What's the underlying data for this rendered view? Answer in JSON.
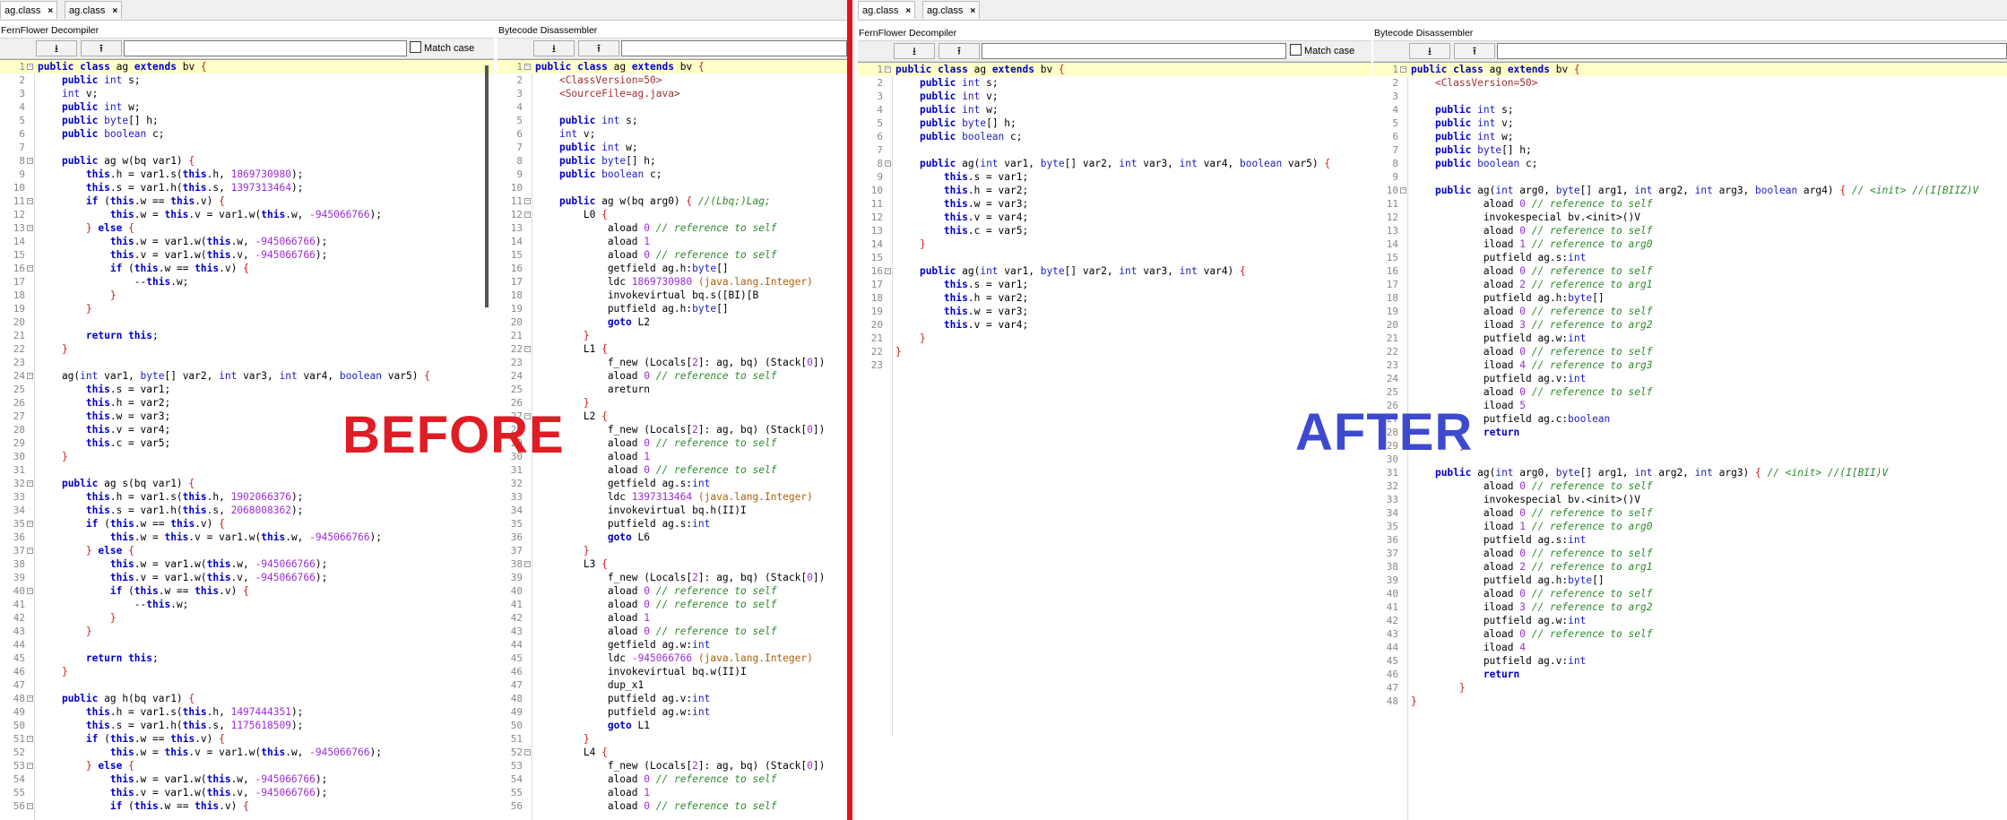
{
  "colors": {
    "before_label": "#e01c24",
    "after_label": "#3d4ad0",
    "divider": "#e0141e",
    "highlight_line": "#ffffc8"
  },
  "left": {
    "tabs": [
      {
        "label": "ag.class",
        "close": "×"
      },
      {
        "label": "ag.class",
        "close": "×"
      }
    ],
    "fernflower": {
      "title": "FernFlower Decompiler",
      "match_case": "Match case",
      "lines": [
        "public class ag extends bv {",
        "    public int s;",
        "    int v;",
        "    public int w;",
        "    public byte[] h;",
        "    public boolean c;",
        "",
        "    public ag w(bq var1) {",
        "        this.h = var1.s(this.h, 1869730980);",
        "        this.s = var1.h(this.s, 1397313464);",
        "        if (this.w == this.v) {",
        "            this.w = this.v = var1.w(this.w, -945066766);",
        "        } else {",
        "            this.w = var1.w(this.w, -945066766);",
        "            this.v = var1.w(this.v, -945066766);",
        "            if (this.w == this.v) {",
        "                --this.w;",
        "            }",
        "        }",
        "",
        "        return this;",
        "    }",
        "",
        "    ag(int var1, byte[] var2, int var3, int var4, boolean var5) {",
        "        this.s = var1;",
        "        this.h = var2;",
        "        this.w = var3;",
        "        this.v = var4;",
        "        this.c = var5;",
        "    }",
        "",
        "    public ag s(bq var1) {",
        "        this.h = var1.s(this.h, 1902066376);",
        "        this.s = var1.h(this.s, 2068008362);",
        "        if (this.w == this.v) {",
        "            this.w = this.v = var1.w(this.w, -945066766);",
        "        } else {",
        "            this.w = var1.w(this.w, -945066766);",
        "            this.v = var1.w(this.v, -945066766);",
        "            if (this.w == this.v) {",
        "                --this.w;",
        "            }",
        "        }",
        "",
        "        return this;",
        "    }",
        "",
        "    public ag h(bq var1) {",
        "        this.h = var1.s(this.h, 1497444351);",
        "        this.s = var1.h(this.s, 1175618509);",
        "        if (this.w == this.v) {",
        "            this.w = this.v = var1.w(this.w, -945066766);",
        "        } else {",
        "            this.w = var1.w(this.w, -945066766);",
        "            this.v = var1.w(this.v, -945066766);",
        "            if (this.w == this.v) {"
      ],
      "folds": [
        1,
        8,
        11,
        13,
        16,
        24,
        32,
        35,
        37,
        40,
        48,
        51,
        53,
        56
      ]
    },
    "bytecode": {
      "title": "Bytecode Disassembler",
      "lines": [
        "public class ag extends bv {",
        "    <ClassVersion=50>",
        "    <SourceFile=ag.java>",
        "",
        "    public int s;",
        "    int v;",
        "    public int w;",
        "    public byte[] h;",
        "    public boolean c;",
        "",
        "    public ag w(bq arg0) { //(Lbq;)Lag;",
        "        L0 {",
        "            aload 0 // reference to self",
        "            aload 1",
        "            aload 0 // reference to self",
        "            getfield ag.h:byte[]",
        "            ldc 1869730980 (java.lang.Integer)",
        "            invokevirtual bq.s([BI)[B",
        "            putfield ag.h:byte[]",
        "            goto L2",
        "        }",
        "        L1 {",
        "            f_new (Locals[2]: ag, bq) (Stack[0])",
        "            aload 0 // reference to self",
        "            areturn",
        "        }",
        "        L2 {",
        "            f_new (Locals[2]: ag, bq) (Stack[0])",
        "            aload 0 // reference to self",
        "            aload 1",
        "            aload 0 // reference to self",
        "            getfield ag.s:int",
        "            ldc 1397313464 (java.lang.Integer)",
        "            invokevirtual bq.h(II)I",
        "            putfield ag.s:int",
        "            goto L6",
        "        }",
        "        L3 {",
        "            f_new (Locals[2]: ag, bq) (Stack[0])",
        "            aload 0 // reference to self",
        "            aload 0 // reference to self",
        "            aload 1",
        "            aload 0 // reference to self",
        "            getfield ag.w:int",
        "            ldc -945066766 (java.lang.Integer)",
        "            invokevirtual bq.w(II)I",
        "            dup_x1",
        "            putfield ag.v:int",
        "            putfield ag.w:int",
        "            goto L1",
        "        }",
        "        L4 {",
        "            f_new (Locals[2]: ag, bq) (Stack[0])",
        "            aload 0 // reference to self",
        "            aload 1",
        "            aload 0 // reference to self"
      ],
      "folds": [
        1,
        11,
        12,
        22,
        27,
        38,
        52
      ]
    },
    "label": "BEFORE"
  },
  "right": {
    "tabs": [
      {
        "label": "ag.class",
        "close": "×"
      },
      {
        "label": "ag.class",
        "close": "×"
      }
    ],
    "fernflower": {
      "title": "FernFlower Decompiler",
      "match_case": "Match case",
      "lines": [
        "public class ag extends bv {",
        "    public int s;",
        "    public int v;",
        "    public int w;",
        "    public byte[] h;",
        "    public boolean c;",
        "",
        "    public ag(int var1, byte[] var2, int var3, int var4, boolean var5) {",
        "        this.s = var1;",
        "        this.h = var2;",
        "        this.w = var3;",
        "        this.v = var4;",
        "        this.c = var5;",
        "    }",
        "",
        "    public ag(int var1, byte[] var2, int var3, int var4) {",
        "        this.s = var1;",
        "        this.h = var2;",
        "        this.w = var3;",
        "        this.v = var4;",
        "    }",
        "}",
        ""
      ],
      "folds": [
        1,
        8,
        16
      ]
    },
    "bytecode": {
      "title": "Bytecode Disassembler",
      "lines": [
        "public class ag extends bv {",
        "    <ClassVersion=50>",
        "",
        "    public int s;",
        "    public int v;",
        "    public int w;",
        "    public byte[] h;",
        "    public boolean c;",
        "",
        "    public ag(int arg0, byte[] arg1, int arg2, int arg3, boolean arg4) { // <init> //(I[BIIZ)V",
        "            aload 0 // reference to self",
        "            invokespecial bv.<init>()V",
        "            aload 0 // reference to self",
        "            iload 1 // reference to arg0",
        "            putfield ag.s:int",
        "            aload 0 // reference to self",
        "            aload 2 // reference to arg1",
        "            putfield ag.h:byte[]",
        "            aload 0 // reference to self",
        "            iload 3 // reference to arg2",
        "            putfield ag.w:int",
        "            aload 0 // reference to self",
        "            iload 4 // reference to arg3",
        "            putfield ag.v:int",
        "            aload 0 // reference to self",
        "            iload 5",
        "            putfield ag.c:boolean",
        "            return",
        "        }",
        "",
        "    public ag(int arg0, byte[] arg1, int arg2, int arg3) { // <init> //(I[BII)V",
        "            aload 0 // reference to self",
        "            invokespecial bv.<init>()V",
        "            aload 0 // reference to self",
        "            iload 1 // reference to arg0",
        "            putfield ag.s:int",
        "            aload 0 // reference to self",
        "            aload 2 // reference to arg1",
        "            putfield ag.h:byte[]",
        "            aload 0 // reference to self",
        "            iload 3 // reference to arg2",
        "            putfield ag.w:int",
        "            aload 0 // reference to self",
        "            iload 4",
        "            putfield ag.v:int",
        "            return",
        "        }",
        "}"
      ],
      "folds": [
        1,
        10
      ]
    },
    "label": "AFTER"
  }
}
